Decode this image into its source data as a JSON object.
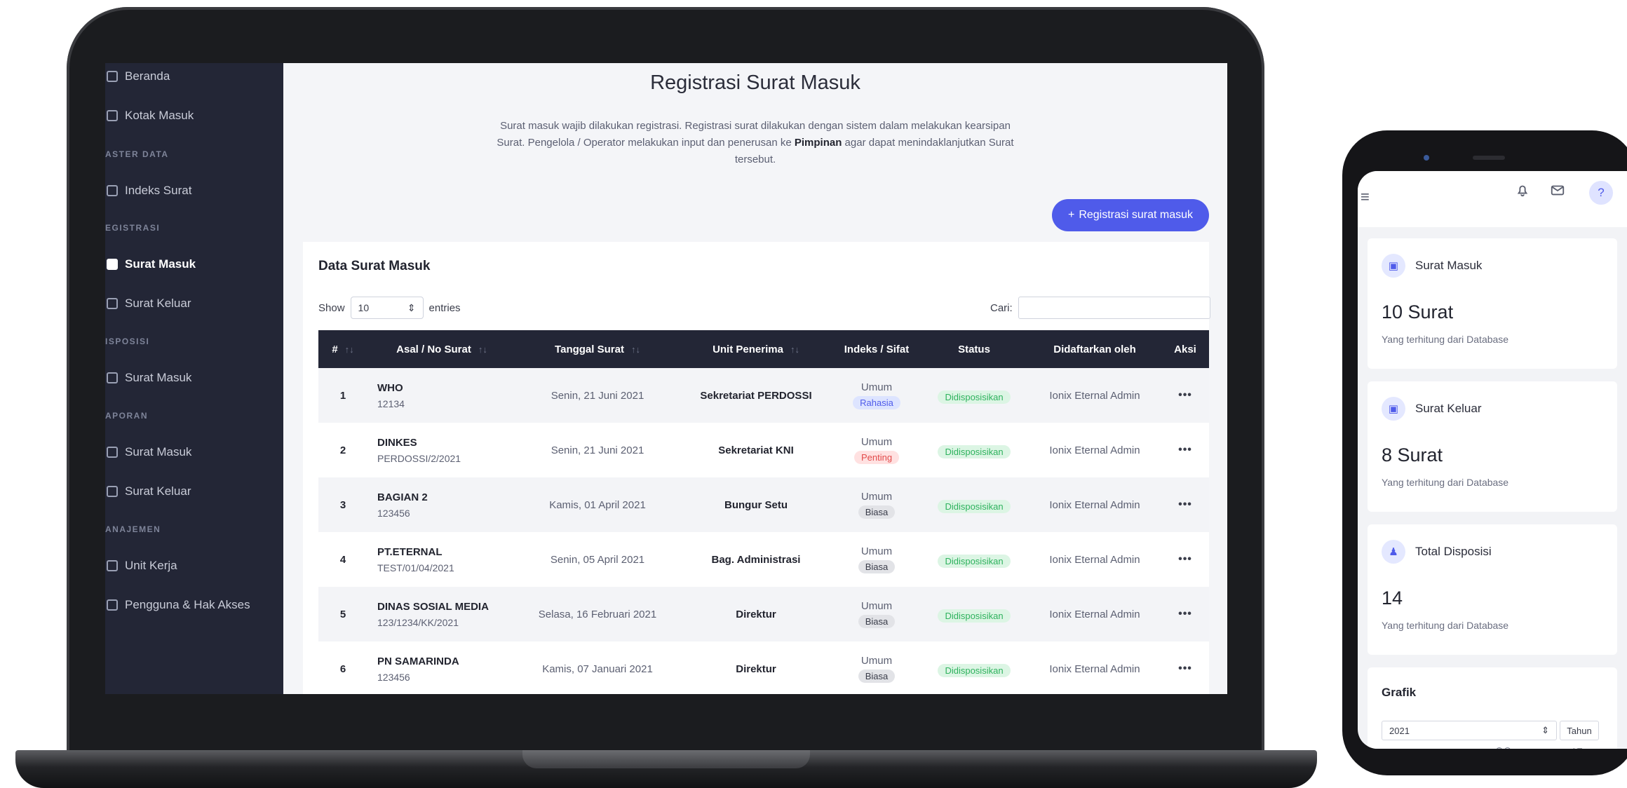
{
  "sidebar": {
    "items": [
      {
        "type": "link",
        "label": "Beranda",
        "icon": "dashboard-icon"
      },
      {
        "type": "link",
        "label": "Kotak Masuk",
        "icon": "inbox-icon"
      },
      {
        "type": "heading",
        "label": "ASTER DATA"
      },
      {
        "type": "link",
        "label": "Indeks Surat",
        "icon": "list-icon"
      },
      {
        "type": "heading",
        "label": "EGISTRASI"
      },
      {
        "type": "link",
        "label": "Surat Masuk",
        "icon": "mail-in-icon",
        "active": true
      },
      {
        "type": "link",
        "label": "Surat Keluar",
        "icon": "mail-out-icon"
      },
      {
        "type": "heading",
        "label": "ISPOSISI"
      },
      {
        "type": "link",
        "label": "Surat Masuk",
        "icon": "disposition-icon"
      },
      {
        "type": "heading",
        "label": "APORAN"
      },
      {
        "type": "link",
        "label": "Surat Masuk",
        "icon": "report-icon"
      },
      {
        "type": "link",
        "label": "Surat Keluar",
        "icon": "report-out-icon"
      },
      {
        "type": "heading",
        "label": "ANAJEMEN"
      },
      {
        "type": "link",
        "label": "Unit Kerja",
        "icon": "briefcase-icon"
      },
      {
        "type": "link",
        "label": "Pengguna & Hak Akses",
        "icon": "users-icon"
      }
    ]
  },
  "main": {
    "title": "Registrasi Surat Masuk",
    "desc_line1": "Surat masuk wajib dilakukan registrasi. Registrasi surat dilakukan dengan sistem dalam melakukan kearsipan",
    "desc_line2_pre": "Surat. Pengelola / Operator melakukan input dan penerusan ke ",
    "desc_line2_bold": "Pimpinan",
    "desc_line2_post": " agar dapat menindaklanjutkan Surat",
    "desc_line3": "tersebut.",
    "register_button": "Registrasi surat masuk",
    "register_icon": "+"
  },
  "table": {
    "title": "Data Surat Masuk",
    "show_label": "Show",
    "show_value": "10",
    "entries_label": "entries",
    "search_label": "Cari:",
    "search_value": "",
    "columns": [
      "#",
      "Asal / No Surat",
      "Tanggal Surat",
      "Unit Penerima",
      "Indeks / Sifat",
      "Status",
      "Didaftarkan oleh",
      "Aksi"
    ],
    "rows": [
      {
        "no": "1",
        "asal": "WHO",
        "nomor": "12134",
        "tanggal": "Senin, 21 Juni 2021",
        "unit": "Sekretariat PERDOSSI",
        "indeks": "Umum",
        "sifat": "Rahasia",
        "status": "Didisposisikan",
        "oleh": "Ionix Eternal Admin",
        "aksi": "•••"
      },
      {
        "no": "2",
        "asal": "DINKES",
        "nomor": "PERDOSSI/2/2021",
        "tanggal": "Senin, 21 Juni 2021",
        "unit": "Sekretariat KNI",
        "indeks": "Umum",
        "sifat": "Penting",
        "status": "Didisposisikan",
        "oleh": "Ionix Eternal Admin",
        "aksi": "•••"
      },
      {
        "no": "3",
        "asal": "BAGIAN 2",
        "nomor": "123456",
        "tanggal": "Kamis, 01 April 2021",
        "unit": "Bungur Setu",
        "indeks": "Umum",
        "sifat": "Biasa",
        "status": "Didisposisikan",
        "oleh": "Ionix Eternal Admin",
        "aksi": "•••"
      },
      {
        "no": "4",
        "asal": "PT.ETERNAL",
        "nomor": "TEST/01/04/2021",
        "tanggal": "Senin, 05 April 2021",
        "unit": "Bag. Administrasi",
        "indeks": "Umum",
        "sifat": "Biasa",
        "status": "Didisposisikan",
        "oleh": "Ionix Eternal Admin",
        "aksi": "•••"
      },
      {
        "no": "5",
        "asal": "DINAS SOSIAL MEDIA",
        "nomor": "123/1234/KK/2021",
        "tanggal": "Selasa, 16 Februari 2021",
        "unit": "Direktur",
        "indeks": "Umum",
        "sifat": "Biasa",
        "status": "Didisposisikan",
        "oleh": "Ionix Eternal Admin",
        "aksi": "•••"
      },
      {
        "no": "6",
        "asal": "PN SAMARINDA",
        "nomor": "123456",
        "tanggal": "Kamis, 07 Januari 2021",
        "unit": "Direktur",
        "indeks": "Umum",
        "sifat": "Biasa",
        "status": "Didisposisikan",
        "oleh": "Ionix Eternal Admin",
        "aksi": "•••"
      }
    ]
  },
  "phone": {
    "menu_icon": "≡",
    "bell_icon": "♫",
    "mail_icon": "✉",
    "help_label": "?",
    "cards": [
      {
        "title": "Surat Masuk",
        "value": "10 Surat",
        "caption": "Yang terhitung dari Database",
        "icon": "inbox-icon"
      },
      {
        "title": "Surat Keluar",
        "value": "8 Surat",
        "caption": "Yang terhitung dari Database",
        "icon": "outbox-icon"
      },
      {
        "title": "Total Disposisi",
        "value": "14",
        "caption": "Yang terhitung dari Database",
        "icon": "user-add-icon"
      }
    ],
    "chart_title": "Grafik",
    "year_value": "2021",
    "period_label": "Tahun",
    "zoom_icons": "⊕⊖",
    "home_icons": "⌂≡"
  },
  "colors": {
    "accent": "#4f5bea",
    "sidebar_bg": "#232636",
    "status_green": "#2eb25d",
    "penting_red": "#e24b4b"
  }
}
